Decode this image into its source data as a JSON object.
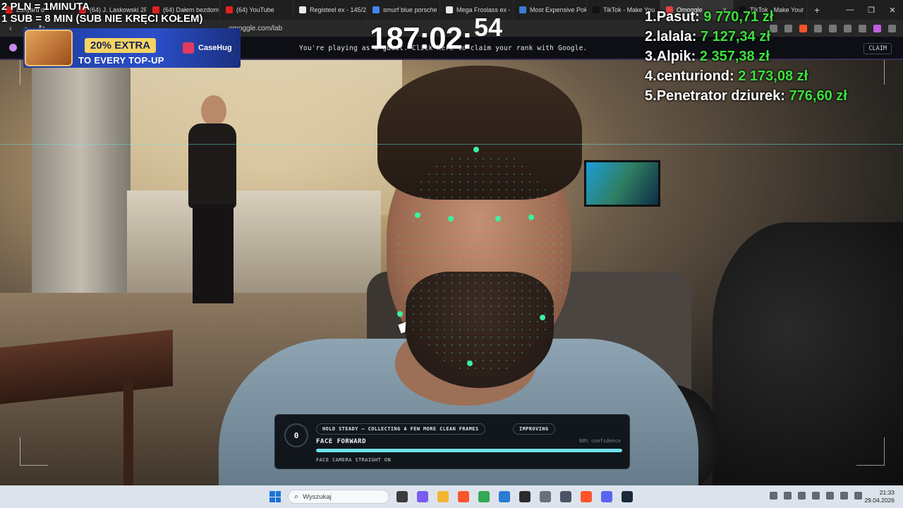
{
  "browser": {
    "tabs": [
      {
        "label": "Lunyard d",
        "favicon_color": "#e02020"
      },
      {
        "label": "(64) J. Laskowski 2PI",
        "favicon_color": "#e02020"
      },
      {
        "label": "(64) Dałem bezdom",
        "favicon_color": "#e02020"
      },
      {
        "label": "(64) YouTube",
        "favicon_color": "#e02020"
      },
      {
        "label": "Registeel ex - 145/2",
        "favicon_color": "#e9e9e9"
      },
      {
        "label": "smurf blue porsche",
        "favicon_color": "#4285f4"
      },
      {
        "label": "Mega Froslass ex -",
        "favicon_color": "#e9e9e9"
      },
      {
        "label": "Most Expensive Pok",
        "favicon_color": "#3b7bd4"
      },
      {
        "label": "TikTok - Make You",
        "favicon_color": "#111111"
      },
      {
        "label": "Omoggle",
        "favicon_color": "#d44",
        "active": true
      },
      {
        "label": "TikTok - Make Your",
        "favicon_color": "#111111"
      }
    ],
    "new_tab_glyph": "+",
    "url": "omoggle.com/lab"
  },
  "site": {
    "guest_message": "You're playing as a guest. Click here to claim your rank with Google.",
    "claim_label": "CLAIM"
  },
  "overlay": {
    "rate_line1": "2 PLN = 1MINUTA",
    "rate_line2": "1 SUB = 8 MIN (SUB NIE KRĘCI KOŁEM)",
    "timer": "187:02:",
    "timer_seconds": "54",
    "leaderboard": [
      {
        "rank": "1.",
        "name": "Pasut:",
        "amount": "9 770,71 zł"
      },
      {
        "rank": "2.",
        "name": "lalala:",
        "amount": "7 127,34 zł"
      },
      {
        "rank": "3.",
        "name": "Alpik:",
        "amount": "2 357,38 zł"
      },
      {
        "rank": "4.",
        "name": "centuriond:",
        "amount": "2 173,08 zł"
      },
      {
        "rank": "5.",
        "name": "Penetrator dziurek:",
        "amount": "776,60 zł"
      }
    ],
    "promo": {
      "headline": "20% EXTRA",
      "subline": "TO EVERY TOP-UP",
      "brand": "CaseHug"
    }
  },
  "scan_panel": {
    "score": "0",
    "status_pill": "HOLD STEADY — COLLECTING A FEW MORE CLEAN FRAMES",
    "trend_pill": "IMPROVING",
    "title": "FACE FORWARD",
    "confidence_text": "80% confidence",
    "progress": 1.0,
    "hint": "FACE CAMERA STRAIGHT ON"
  },
  "taskbar": {
    "search_placeholder": "Wyszukaj",
    "apps": [
      {
        "name": "task-view-icon",
        "color": "#3b3b3b"
      },
      {
        "name": "copilot-icon",
        "color": "#7a5cf0"
      },
      {
        "name": "file-explorer-icon",
        "color": "#f2b530"
      },
      {
        "name": "brave-icon",
        "color": "#fb542b"
      },
      {
        "name": "chrome-icon",
        "color": "#34a853"
      },
      {
        "name": "store-icon",
        "color": "#2a7bd4"
      },
      {
        "name": "obs-icon",
        "color": "#2b2b2b"
      },
      {
        "name": "settings-icon",
        "color": "#6a6f7a"
      },
      {
        "name": "calculator-icon",
        "color": "#4a5466"
      },
      {
        "name": "brave-active-icon",
        "color": "#fb542b"
      },
      {
        "name": "discord-icon",
        "color": "#5865f2"
      },
      {
        "name": "steam-icon",
        "color": "#1b2838"
      }
    ],
    "time": "21:33",
    "date": "29.04.2026"
  },
  "colors": {
    "leaderboard_amount": "#3ee03e",
    "scan_progress": "#6fe2ea",
    "mesh_point": "#3df0a0"
  }
}
